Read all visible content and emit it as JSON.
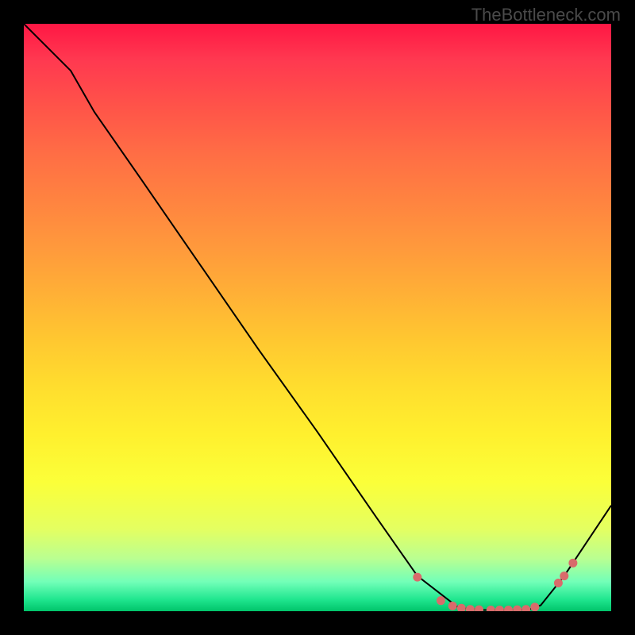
{
  "watermark": "TheBottleneck.com",
  "chart_data": {
    "type": "line",
    "title": "",
    "xlabel": "",
    "ylabel": "",
    "xlim": [
      0,
      100
    ],
    "ylim": [
      0,
      100
    ],
    "grid": false,
    "background": "gradient-red-to-green-vertical",
    "series": [
      {
        "name": "bottleneck-curve",
        "x": [
          0,
          8,
          12,
          20,
          30,
          40,
          50,
          60,
          67,
          74,
          78,
          82,
          86,
          88,
          92,
          96,
          100
        ],
        "values": [
          100,
          92,
          85,
          73.5,
          59,
          44.5,
          30.5,
          16,
          6,
          0.6,
          0.2,
          0.2,
          0.3,
          1,
          6,
          12,
          18
        ]
      }
    ],
    "highlighted_points": {
      "name": "optimal-range-markers",
      "color": "#d96b6b",
      "x": [
        67,
        71,
        73,
        74.5,
        76,
        77.5,
        79.5,
        81,
        82.5,
        84,
        85.5,
        87,
        91,
        92,
        93.5
      ],
      "values": [
        5.8,
        1.8,
        0.9,
        0.5,
        0.3,
        0.25,
        0.2,
        0.2,
        0.2,
        0.25,
        0.3,
        0.7,
        4.8,
        6.0,
        8.2
      ]
    }
  }
}
